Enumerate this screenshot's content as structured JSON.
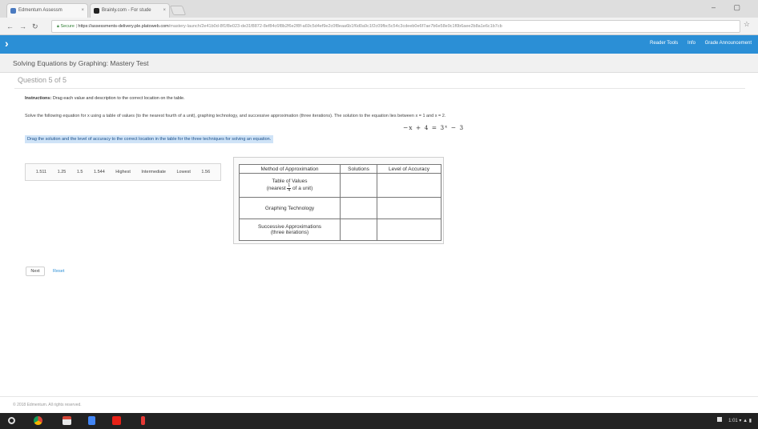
{
  "browser": {
    "tabs": [
      {
        "label": "Edmentum Assessm",
        "close": "×",
        "color": "#4a7ac0"
      },
      {
        "label": "Brainly.com - For stude",
        "close": "×",
        "color": "#222222"
      }
    ],
    "window_controls": "– ▢",
    "secure_label": "Secure",
    "url_host": "https://assessments-delivery.ple.platoweb.com",
    "url_path": "/mastery-launch/2e41b0d-8f1f8e023-de31f8872-8ef84c6f8b2f6e2f8f-a69c5d4ef9e2c0f8eaa6b1f6d0a9c1f2c09fbc5c54c3cdeeb0e6f7ae7b6e58e9c1f0b6aee2b8a1e6c1b7cb"
  },
  "app_bar": {
    "accent": "#2b8fd6",
    "links": [
      "Reader Tools",
      "Info",
      "Grade Announcement"
    ]
  },
  "page": {
    "title": "Solving Equations by Graphing: Mastery Test",
    "question_number": "Question 5 of 5",
    "instructions_label": "Instructions:",
    "instructions_text": "Drag each value and description to the correct location on the table.",
    "prompt": "Solve the following equation for x using a table of values (to the nearest fourth of a unit), graphing technology, and successive approximation (three iterations). The solution to the equation lies between x = 1 and x = 2.",
    "equation": "−x + 4 = 3ˣ − 3",
    "drag_instruction": "Drag the solution and the level of accuracy to the correct location in the table for the three techniques for solving an equation."
  },
  "tiles": [
    "1.511",
    "1.25",
    "1.5",
    "1.544",
    "Highest",
    "Intermediate",
    "Lowest",
    "1.56"
  ],
  "table": {
    "headers": [
      "Method of Approximation",
      "Solutions",
      "Level of Accuracy"
    ],
    "row1_line1": "Table of Values",
    "row1_pre": "(nearest",
    "row1_num": "1",
    "row1_den": "4",
    "row1_post": "of a unit)",
    "row2": "Graphing Technology",
    "row3_line1": "Successive Approximations",
    "row3_line2": "(three iterations)"
  },
  "buttons": {
    "next": "Next",
    "reset": "Reset"
  },
  "footer": "© 2018 Edmentum. All rights reserved.",
  "tray": {
    "time": "1:01 ▾ ▲ ▮"
  }
}
